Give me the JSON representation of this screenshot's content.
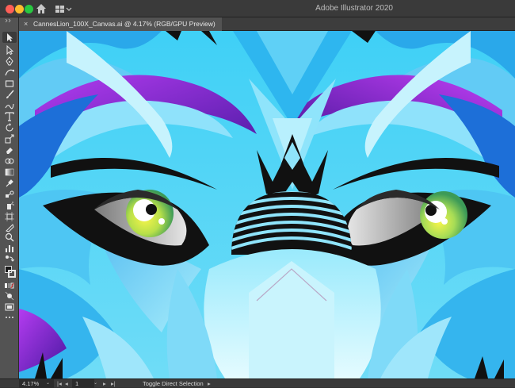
{
  "app": {
    "title": "Adobe Illustrator 2020"
  },
  "titlebar": {
    "home_icon": "home-icon",
    "workspace_icon": "workspace-switcher-icon"
  },
  "document": {
    "tab_label": "CannesLion_100X_Canvas.ai @ 4.17% (RGB/GPU Preview)",
    "close_glyph": "×"
  },
  "toolbar": {
    "tools": [
      "selection",
      "direct-selection",
      "pen",
      "curvature",
      "rectangle",
      "paintbrush",
      "shaper",
      "type",
      "rotate",
      "scale",
      "eraser",
      "shape-builder",
      "gradient",
      "eyedropper",
      "blend",
      "symbol-sprayer",
      "artboard",
      "slice",
      "zoom",
      "hand",
      "column-graph",
      "fill-stroke",
      "color-mode",
      "draw-mode",
      "screen-mode",
      "edit-toolbar"
    ]
  },
  "statusbar": {
    "zoom": "4.17%",
    "page": "1",
    "tool_hint": "Toggle Direct Selection",
    "prev_first": "|◂",
    "prev": "◂",
    "next": "▸",
    "next_last": "▸|",
    "dropdown": "⌄",
    "menu_arrow": "▸"
  },
  "colors": {
    "chrome_dark": "#323232",
    "toolbar": "#535353",
    "artwork_cyan": "#55d4f4",
    "artwork_purple": "#8a2be2",
    "eye_yellow": "#f3f05a"
  }
}
